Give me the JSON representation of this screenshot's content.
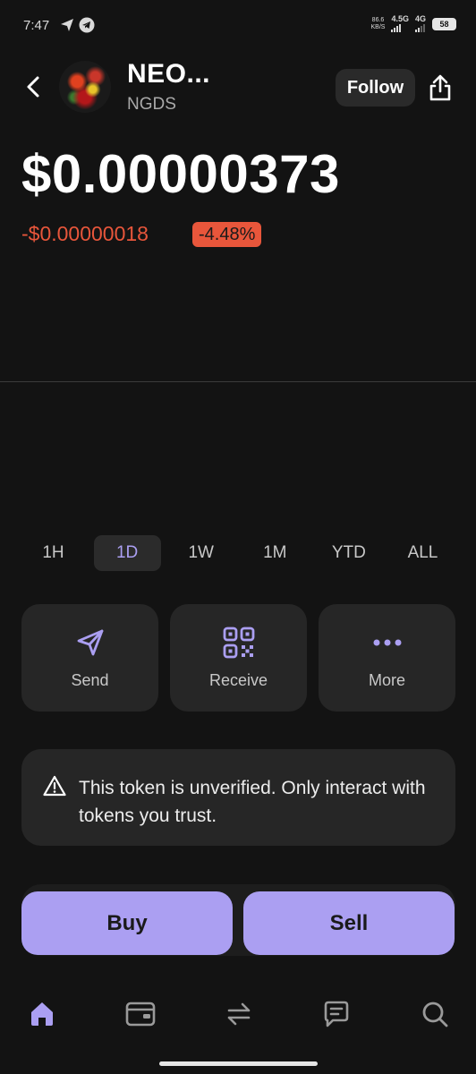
{
  "status_bar": {
    "time": "7:47",
    "net_speed_value": "86.6",
    "net_speed_unit": "KB/S",
    "network_1": "4.5G",
    "network_2": "4G",
    "battery": "58"
  },
  "header": {
    "token_name": "NEO...",
    "token_symbol": "NGDS",
    "follow_label": "Follow"
  },
  "price": {
    "value": "$0.00000373",
    "change": "-$0.00000018",
    "change_pct": "-4.48%"
  },
  "time_ranges": {
    "items": [
      {
        "label": "1H",
        "active": false
      },
      {
        "label": "1D",
        "active": true
      },
      {
        "label": "1W",
        "active": false
      },
      {
        "label": "1M",
        "active": false
      },
      {
        "label": "YTD",
        "active": false
      },
      {
        "label": "ALL",
        "active": false
      }
    ]
  },
  "actions": {
    "send_label": "Send",
    "receive_label": "Receive",
    "more_label": "More"
  },
  "warning": {
    "text": "This token is unverified. Only interact with tokens you trust."
  },
  "trade": {
    "buy_label": "Buy",
    "sell_label": "Sell"
  },
  "bottom_nav": {
    "items": [
      "home-icon",
      "wallet-icon",
      "swap-icon",
      "chat-icon",
      "search-icon"
    ],
    "active": "home-icon"
  },
  "colors": {
    "background": "#131313",
    "accent": "#ab9ff2",
    "negative": "#e8563b",
    "card": "#262626"
  }
}
